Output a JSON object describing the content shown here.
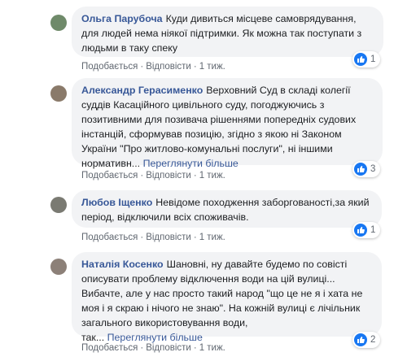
{
  "actions": {
    "like": "Подобається",
    "reply": "Відповісти",
    "sep": "·"
  },
  "comments": [
    {
      "author": "Ольга Парубоча",
      "lines": [
        "Куди дивиться місцеве самоврядування,",
        "для людей нема ніякої підтримки. Як можна так поступати з",
        "людьми в таку спеку"
      ],
      "see_more": "",
      "time": "1 тиж.",
      "reactions": "1"
    },
    {
      "author": "Александр Герасименко",
      "lines": [
        "Верховний Суд в складі колегії",
        "суддів Касаційного цивільного суду, погоджуючись з",
        "позитивними для позивача рішеннями попередніх судових",
        "інстанцій, сформував позицію, згідно з якою ні Законом",
        "України \"Про житлово-комунальні послуги\", ні іншими",
        "нормативн... "
      ],
      "see_more": "Переглянути більше",
      "time": "1 тиж.",
      "reactions": "3"
    },
    {
      "author": "Любов Іщенко",
      "lines": [
        "Невідоме походження заборгованості,за який",
        "період, відключили всіх споживачів."
      ],
      "see_more": "",
      "time": "1 тиж.",
      "reactions": "1"
    },
    {
      "author": "Наталія Косенко",
      "lines": [
        "Шановні, ну давайте будемо по совісті",
        "описувати проблему відключення води на цій вулиці...",
        "Вибачте, але у нас просто такий народ \"що це не я і хата не",
        "моя і я скраю і нічого не знаю\". На кожній вулиці є лічільник",
        "загального використовування води,",
        "так... "
      ],
      "see_more": "Переглянути більше",
      "time": "1 тиж.",
      "reactions": "2"
    }
  ]
}
